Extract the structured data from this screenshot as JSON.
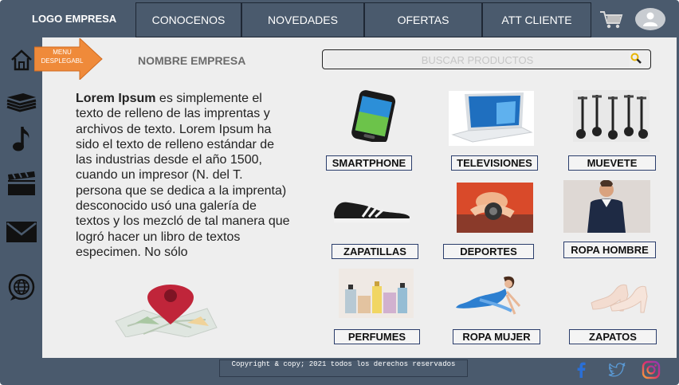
{
  "header": {
    "logo": "LOGO EMPRESA",
    "nav": [
      "CONOCENOS",
      "NOVEDADES",
      "OFERTAS",
      "ATT CLIENTE"
    ]
  },
  "sidebar": {
    "icons": [
      "home-icon",
      "books-icon",
      "music-note-icon",
      "clapperboard-icon",
      "mail-icon",
      "globe-chat-icon"
    ]
  },
  "menu": {
    "label": "MENU DESPLEGABL"
  },
  "company_name": "NOMBRE EMPRESA",
  "search": {
    "placeholder": "BUSCAR PRODUCTOS"
  },
  "intro": {
    "bold": "Lorem Ipsum",
    "text": " es simplemente el texto de relleno de las imprentas y archivos de texto. Lorem Ipsum ha sido el texto de relleno estándar de las industrias desde el año 1500, cuando un impresor (N. del T. persona que se dedica a la imprenta) desconocido usó una galería de textos y los mezcló de tal manera que logró hacer un libro de textos especimen. No sólo"
  },
  "products": [
    {
      "label": "SMARTPHONE"
    },
    {
      "label": "TELEVISIONES"
    },
    {
      "label": "MUEVETE"
    },
    {
      "label": "ZAPATILLAS"
    },
    {
      "label": "DEPORTES"
    },
    {
      "label": "ROPA HOMBRE"
    },
    {
      "label": "PERFUMES"
    },
    {
      "label": "ROPA MUJER"
    },
    {
      "label": "ZAPATOS"
    }
  ],
  "footer": {
    "copyright": "Copyright & copy; 2021 todos los derechos reservados",
    "social": [
      "facebook-icon",
      "twitter-icon",
      "instagram-icon"
    ]
  },
  "colors": {
    "chrome": "#4a5a6d",
    "content_bg": "#eeeeee",
    "menu_arrow": "#ef8a3a",
    "label_border": "#2a3d6b",
    "search_icon": "#e8b400"
  }
}
